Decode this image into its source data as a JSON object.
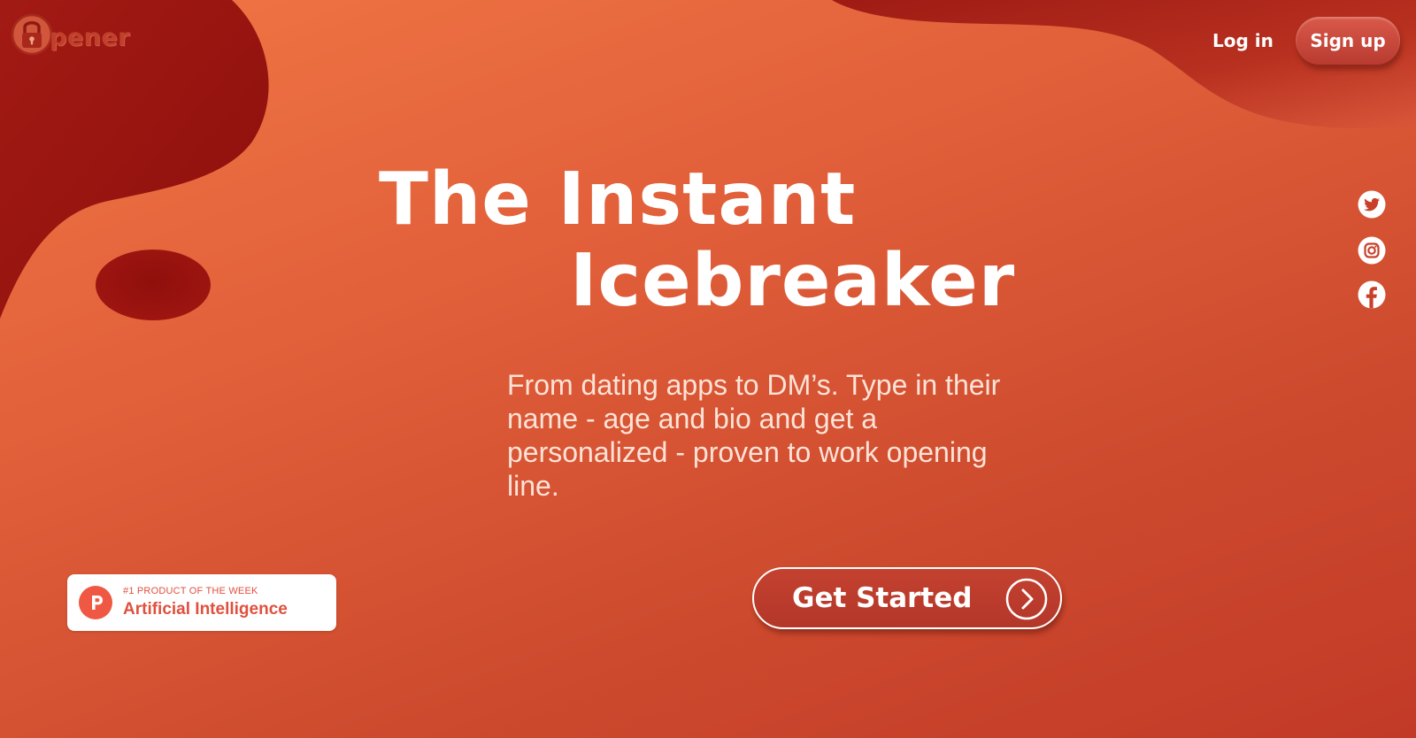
{
  "brand": {
    "name": "pener",
    "icon": "padlock-icon",
    "color": "#c0402c"
  },
  "header": {
    "login_label": "Log in",
    "signup_label": "Sign up"
  },
  "social": [
    {
      "name": "twitter",
      "icon": "twitter-icon"
    },
    {
      "name": "instagram",
      "icon": "instagram-icon"
    },
    {
      "name": "facebook",
      "icon": "facebook-icon"
    }
  ],
  "hero": {
    "title_line1": "The Instant",
    "title_line2": "Icebreaker",
    "tagline": "From dating apps to DM’s. Type in their name - age and bio and get a personalized - proven to work opening line."
  },
  "badge": {
    "kicker": "#1 PRODUCT OF THE WEEK",
    "title": "Artificial Intelligence",
    "icon": "product-hunt-icon",
    "color": "#e0503e"
  },
  "cta": {
    "label": "Get Started",
    "icon": "chevron-right-icon"
  },
  "colors": {
    "background_top": "#f07645",
    "background_bottom": "#c23a27",
    "blob_dark": "#9a1712",
    "accent_white": "#ffffff"
  }
}
